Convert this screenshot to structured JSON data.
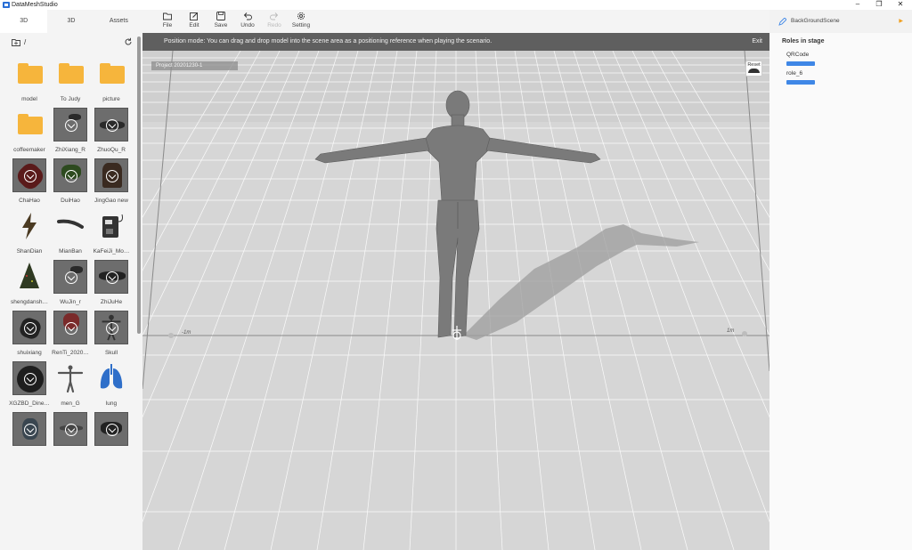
{
  "window": {
    "title": "DataMeshStudio",
    "controls": [
      "–",
      "❐",
      "✕"
    ]
  },
  "left_panel": {
    "tabs": [
      {
        "label": "3D",
        "active": true
      },
      {
        "label": "3D",
        "active": false
      },
      {
        "label": "Assets",
        "active": false
      }
    ],
    "path": "/",
    "assets": [
      {
        "label": "model",
        "kind": "folder"
      },
      {
        "label": "To Judy",
        "kind": "folder"
      },
      {
        "label": "picture",
        "kind": "folder"
      },
      {
        "label": "coffeemaker",
        "kind": "folder"
      },
      {
        "label": "ZhiXiang_R",
        "kind": "download"
      },
      {
        "label": "ZhuoQu_R",
        "kind": "download"
      },
      {
        "label": "ChaHao",
        "kind": "download"
      },
      {
        "label": "DuiHao",
        "kind": "download"
      },
      {
        "label": "JingGao new",
        "kind": "download"
      },
      {
        "label": "ShanDian",
        "kind": "model"
      },
      {
        "label": "MianBan",
        "kind": "model"
      },
      {
        "label": "KaFeiJi_Mo…",
        "kind": "model"
      },
      {
        "label": "shengdansh…",
        "kind": "model"
      },
      {
        "label": "WuJin_r",
        "kind": "download"
      },
      {
        "label": "ZhiJuHe",
        "kind": "download"
      },
      {
        "label": "shuixiang",
        "kind": "download"
      },
      {
        "label": "RenTi_2020…",
        "kind": "download"
      },
      {
        "label": "Skull",
        "kind": "download"
      },
      {
        "label": "XGZBD_Dine…",
        "kind": "download"
      },
      {
        "label": "men_G",
        "kind": "model"
      },
      {
        "label": "lung",
        "kind": "model"
      },
      {
        "label": "",
        "kind": "download"
      },
      {
        "label": "",
        "kind": "download"
      },
      {
        "label": "",
        "kind": "download"
      }
    ]
  },
  "toolbar": {
    "items": [
      {
        "label": "File",
        "icon": "folder-icon",
        "enabled": true
      },
      {
        "label": "Edit",
        "icon": "edit-icon",
        "enabled": true
      },
      {
        "label": "Save",
        "icon": "save-icon",
        "enabled": true
      },
      {
        "label": "Undo",
        "icon": "undo-icon",
        "enabled": true
      },
      {
        "label": "Redo",
        "icon": "redo-icon",
        "enabled": false
      },
      {
        "label": "Setting",
        "icon": "gear-icon",
        "enabled": true
      }
    ]
  },
  "scene": {
    "notice": "Position mode: You can drag and drop model into the scene area as a positioning reference when playing the scenario.",
    "exit_label": "Exit",
    "project_label": "Project 20201230-1",
    "reset_label": "Reset",
    "axis_left": "-1m",
    "axis_right": "1m"
  },
  "right_panel": {
    "scene_name": "BackGroundScene",
    "roles_title": "Roles in stage",
    "roles": [
      {
        "name": "QRCode",
        "color": "#3f87e6"
      },
      {
        "name": "role_6",
        "color": "#3f87e6"
      }
    ]
  },
  "colors": {
    "accent": "#3f87e6",
    "folder": "#f6b53c",
    "notice_bar": "#5f5f5f",
    "floor": "#d4d4d4"
  }
}
